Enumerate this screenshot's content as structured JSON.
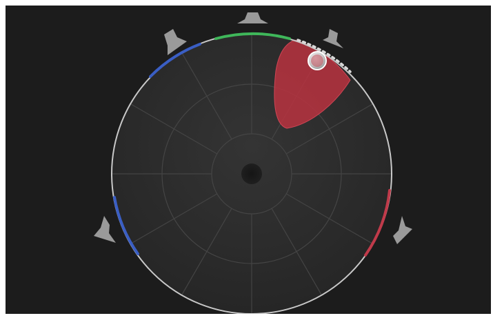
{
  "panner": {
    "type": "surround-panner",
    "speakers": [
      {
        "name": "center",
        "color": "#9a9a9a"
      },
      {
        "name": "left-front",
        "color": "#9a9a9a"
      },
      {
        "name": "right-front",
        "color": "#9a9a9a"
      },
      {
        "name": "left-surround",
        "color": "#9a9a9a"
      },
      {
        "name": "right-surround",
        "color": "#9a9a9a"
      }
    ],
    "rings": 3,
    "spokes": 12,
    "colors": {
      "background": "#1c1c1c",
      "disc": "#2d2d2d",
      "rim": "#c8c8c8",
      "grid": "#444444",
      "green_arc": "#3fb75a",
      "blue_arc": "#3a5ec4",
      "red_arc": "#c03a4a",
      "lobe": "#c0303f",
      "puck": "#d8d8d8"
    }
  }
}
